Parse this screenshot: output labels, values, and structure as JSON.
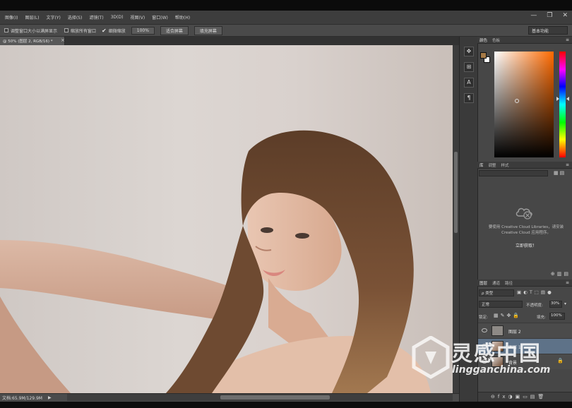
{
  "menu": {
    "items": [
      "图像(I)",
      "图层(L)",
      "文字(Y)",
      "选择(S)",
      "滤镜(T)",
      "3D(D)",
      "视图(V)",
      "窗口(W)",
      "帮助(H)"
    ]
  },
  "window_controls": [
    "—",
    "❐",
    "✕"
  ],
  "options_bar": {
    "resize_windows": "调整窗口大小以满屏显示",
    "zoom_all": "缩放所有窗口",
    "scrubby_zoom": "细微缩放",
    "zoom_100": "100%",
    "fit_screen": "适合屏幕",
    "fill_screen": "填充屏幕",
    "workspace": "基本功能"
  },
  "document": {
    "tab_title": "@ 50% (图层 2, RGB/16) *",
    "close_glyph": "×",
    "status": "文档:65.9M/129.9M",
    "status_arrow": "▶"
  },
  "color_panel": {
    "tabs": [
      "颜色",
      "色板"
    ],
    "foreground": "#a57a46",
    "background": "#ffffff"
  },
  "library_panel": {
    "tabs": [
      "库",
      "调整",
      "样式"
    ],
    "message": "要使用 Creative Cloud Libraries，请安装 Creative Cloud 应用程序。",
    "link": "立即获取！"
  },
  "layers_panel": {
    "tabs": [
      "图层",
      "通道",
      "路径"
    ],
    "filter": "ρ 类型",
    "blend_mode": "正常",
    "opacity_label": "不透明度:",
    "opacity_value": "30%",
    "lock_label": "锁定:",
    "fill_label": "填充:",
    "fill_value": "100%",
    "layers": [
      {
        "name": "图层 2"
      },
      {
        "name": "图层 1"
      },
      {
        "name": "背景"
      }
    ]
  },
  "watermark": {
    "chinese": "灵感中国",
    "english": "lingganchina.com"
  }
}
